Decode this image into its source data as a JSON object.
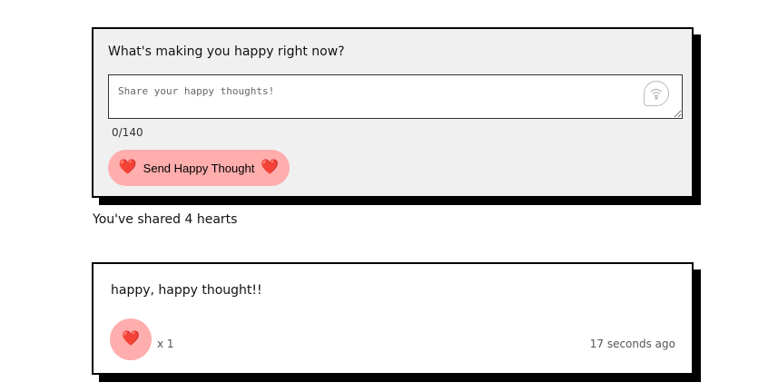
{
  "compose": {
    "prompt": "What's making you happy right now?",
    "placeholder": "Share your happy thoughts!",
    "value": "",
    "char_count": "0/140",
    "send_label": "Send Happy Thought",
    "heart_emoji": "❤️"
  },
  "stats": {
    "hearts_shared": "You've shared 4 hearts"
  },
  "thoughts": [
    {
      "message": "happy, happy thought!!",
      "like_emoji": "❤️",
      "likes": "x 1",
      "time_ago": "17 seconds ago"
    }
  ],
  "colors": {
    "button_pink": "#ffadad",
    "card_gray": "#f0f0f0",
    "shadow": "#000000"
  }
}
